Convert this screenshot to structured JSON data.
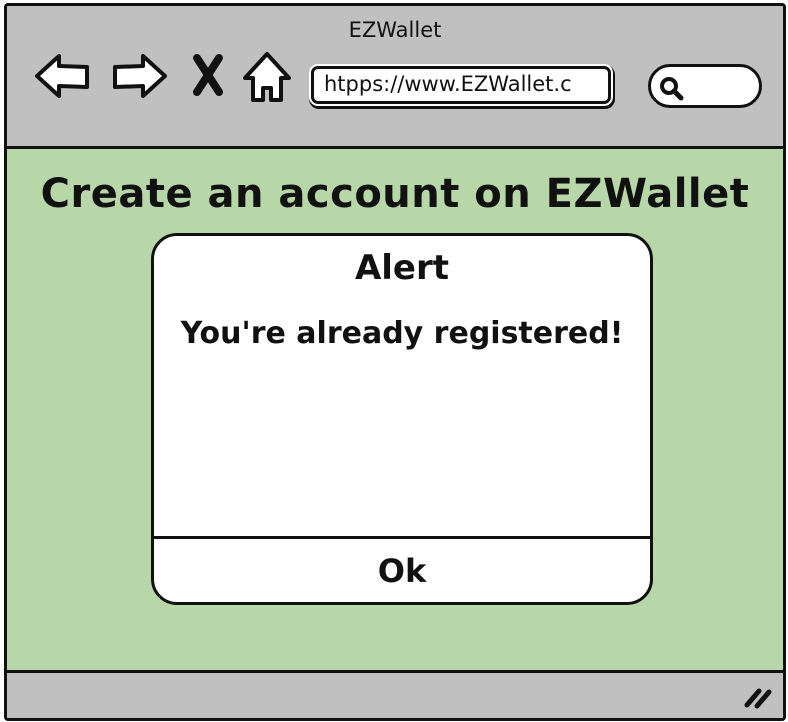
{
  "window": {
    "title": "EZWallet"
  },
  "toolbar": {
    "back_icon": "back-arrow-icon",
    "forward_icon": "forward-arrow-icon",
    "close_icon": "close-x-icon",
    "home_icon": "home-icon",
    "url": "htpps://www.EZWallet.c",
    "search_icon": "magnifier-icon"
  },
  "page": {
    "title": "Create an account on EZWallet",
    "background_color": "#b7d7a8"
  },
  "dialog": {
    "title": "Alert",
    "message": "You're already registered!",
    "ok_label": "Ok"
  },
  "statusbar": {
    "resize_icon": "resize-grip-icon"
  }
}
